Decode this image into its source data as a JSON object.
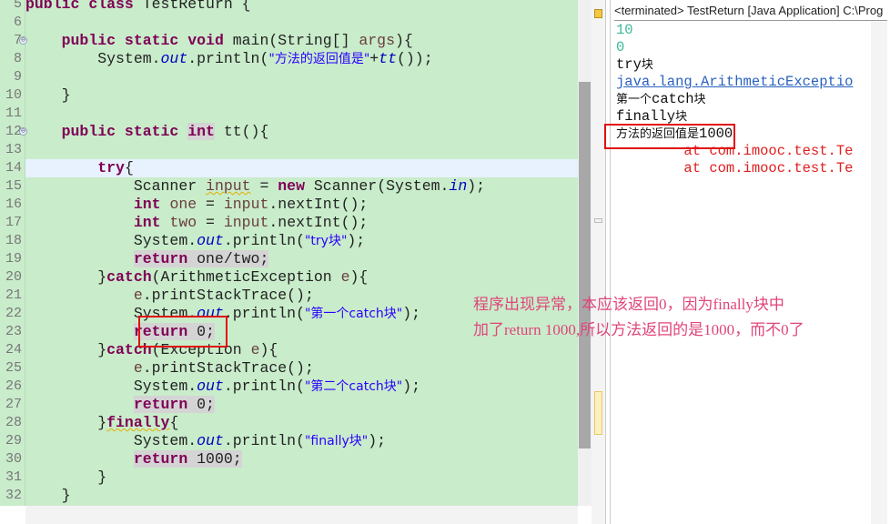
{
  "editor": {
    "first_line": 5,
    "current_line": 14,
    "fold_lines": [
      7,
      12
    ],
    "lines": [
      [
        [
          "public ",
          "kw"
        ],
        [
          "class ",
          "kw"
        ],
        [
          "TestReturn {",
          ""
        ]
      ],
      [],
      [
        [
          "    ",
          ""
        ],
        [
          "public ",
          "kw"
        ],
        [
          "static ",
          "kw"
        ],
        [
          "void ",
          "kw"
        ],
        [
          "main(String[] ",
          ""
        ],
        [
          "args",
          "var"
        ],
        [
          "){",
          ""
        ]
      ],
      [
        [
          "        System.",
          ""
        ],
        [
          "out",
          "fld"
        ],
        [
          ".println(",
          ""
        ],
        [
          "\"方法的返回值是\"",
          "str"
        ],
        [
          "+",
          ""
        ],
        [
          "tt",
          "fld"
        ],
        [
          "());",
          ""
        ]
      ],
      [],
      [
        [
          "    }",
          ""
        ]
      ],
      [],
      [
        [
          "    ",
          ""
        ],
        [
          "public ",
          "kw"
        ],
        [
          "static ",
          "kw"
        ],
        [
          "int",
          "kw hl"
        ],
        [
          " tt(){",
          ""
        ]
      ],
      [],
      [
        [
          "        ",
          ""
        ],
        [
          "try",
          "kw"
        ],
        [
          "{",
          ""
        ]
      ],
      [
        [
          "            Scanner ",
          ""
        ],
        [
          "input",
          "var warn"
        ],
        [
          " = ",
          ""
        ],
        [
          "new ",
          "kw"
        ],
        [
          "Scanner(System.",
          ""
        ],
        [
          "in",
          "fld"
        ],
        [
          ");",
          ""
        ]
      ],
      [
        [
          "            ",
          ""
        ],
        [
          "int ",
          "kw"
        ],
        [
          "one",
          "var"
        ],
        [
          " = ",
          ""
        ],
        [
          "input",
          "var"
        ],
        [
          ".nextInt();",
          ""
        ]
      ],
      [
        [
          "            ",
          ""
        ],
        [
          "int ",
          "kw"
        ],
        [
          "two",
          "var"
        ],
        [
          " = ",
          ""
        ],
        [
          "input",
          "var"
        ],
        [
          ".nextInt();",
          ""
        ]
      ],
      [
        [
          "            System.",
          ""
        ],
        [
          "out",
          "fld"
        ],
        [
          ".println(",
          ""
        ],
        [
          "\"try块\"",
          "str"
        ],
        [
          ");",
          ""
        ]
      ],
      [
        [
          "            ",
          ""
        ],
        [
          "return ",
          "kw hl"
        ],
        [
          "one/two;",
          "hl"
        ]
      ],
      [
        [
          "        }",
          ""
        ],
        [
          "catch",
          "kw"
        ],
        [
          "(ArithmeticException ",
          ""
        ],
        [
          "e",
          "var"
        ],
        [
          "){",
          ""
        ]
      ],
      [
        [
          "            ",
          ""
        ],
        [
          "e",
          "var"
        ],
        [
          ".printStackTrace();",
          ""
        ]
      ],
      [
        [
          "            System.",
          ""
        ],
        [
          "out",
          "fld"
        ],
        [
          ".println(",
          ""
        ],
        [
          "\"第一个catch块\"",
          "str"
        ],
        [
          ");",
          ""
        ]
      ],
      [
        [
          "            ",
          ""
        ],
        [
          "return ",
          "kw hl"
        ],
        [
          "0;",
          "hl"
        ]
      ],
      [
        [
          "        }",
          ""
        ],
        [
          "catch",
          "kw"
        ],
        [
          "(Exception ",
          ""
        ],
        [
          "e",
          "var"
        ],
        [
          "){",
          ""
        ]
      ],
      [
        [
          "            ",
          ""
        ],
        [
          "e",
          "var"
        ],
        [
          ".printStackTrace();",
          ""
        ]
      ],
      [
        [
          "            System.",
          ""
        ],
        [
          "out",
          "fld"
        ],
        [
          ".println(",
          ""
        ],
        [
          "\"第二个catch块\"",
          "str"
        ],
        [
          ");",
          ""
        ]
      ],
      [
        [
          "            ",
          ""
        ],
        [
          "return ",
          "kw hl"
        ],
        [
          "0;",
          "hl"
        ]
      ],
      [
        [
          "        }",
          ""
        ],
        [
          "finally",
          "kw warn"
        ],
        [
          "{",
          ""
        ]
      ],
      [
        [
          "            System.",
          ""
        ],
        [
          "out",
          "fld"
        ],
        [
          ".println(",
          ""
        ],
        [
          "\"finally块\"",
          "str"
        ],
        [
          ");",
          ""
        ]
      ],
      [
        [
          "            ",
          ""
        ],
        [
          "return ",
          "kw hl"
        ],
        [
          "1000;",
          "hl"
        ]
      ],
      [
        [
          "        }",
          ""
        ]
      ],
      [
        [
          "    }",
          ""
        ]
      ]
    ]
  },
  "console": {
    "header": "<terminated> TestReturn [Java Application] C:\\Prog",
    "lines": [
      {
        "text": "10",
        "color": "#3cb89a"
      },
      {
        "text": "0",
        "color": "#3cb89a"
      },
      {
        "text": "try块",
        "color": "#111"
      },
      {
        "text": "java.lang.ArithmeticExceptio",
        "color": "#2a62c0",
        "link": true
      },
      {
        "text": "第一个catch块",
        "color": "#111"
      },
      {
        "text": "finally块",
        "color": "#111"
      },
      {
        "text": "方法的返回值是1000",
        "color": "#111"
      },
      {
        "text": "        at com.imooc.test.Te",
        "color": "#e02020"
      },
      {
        "text": "        at com.imooc.test.Te",
        "color": "#e02020"
      }
    ]
  },
  "annotation": {
    "line1": "程序出现异常，本应该返回0，因为finally块中",
    "line2": "加了return 1000,所以方法返回的是1000，而不0了",
    "color": "#e0457a"
  }
}
